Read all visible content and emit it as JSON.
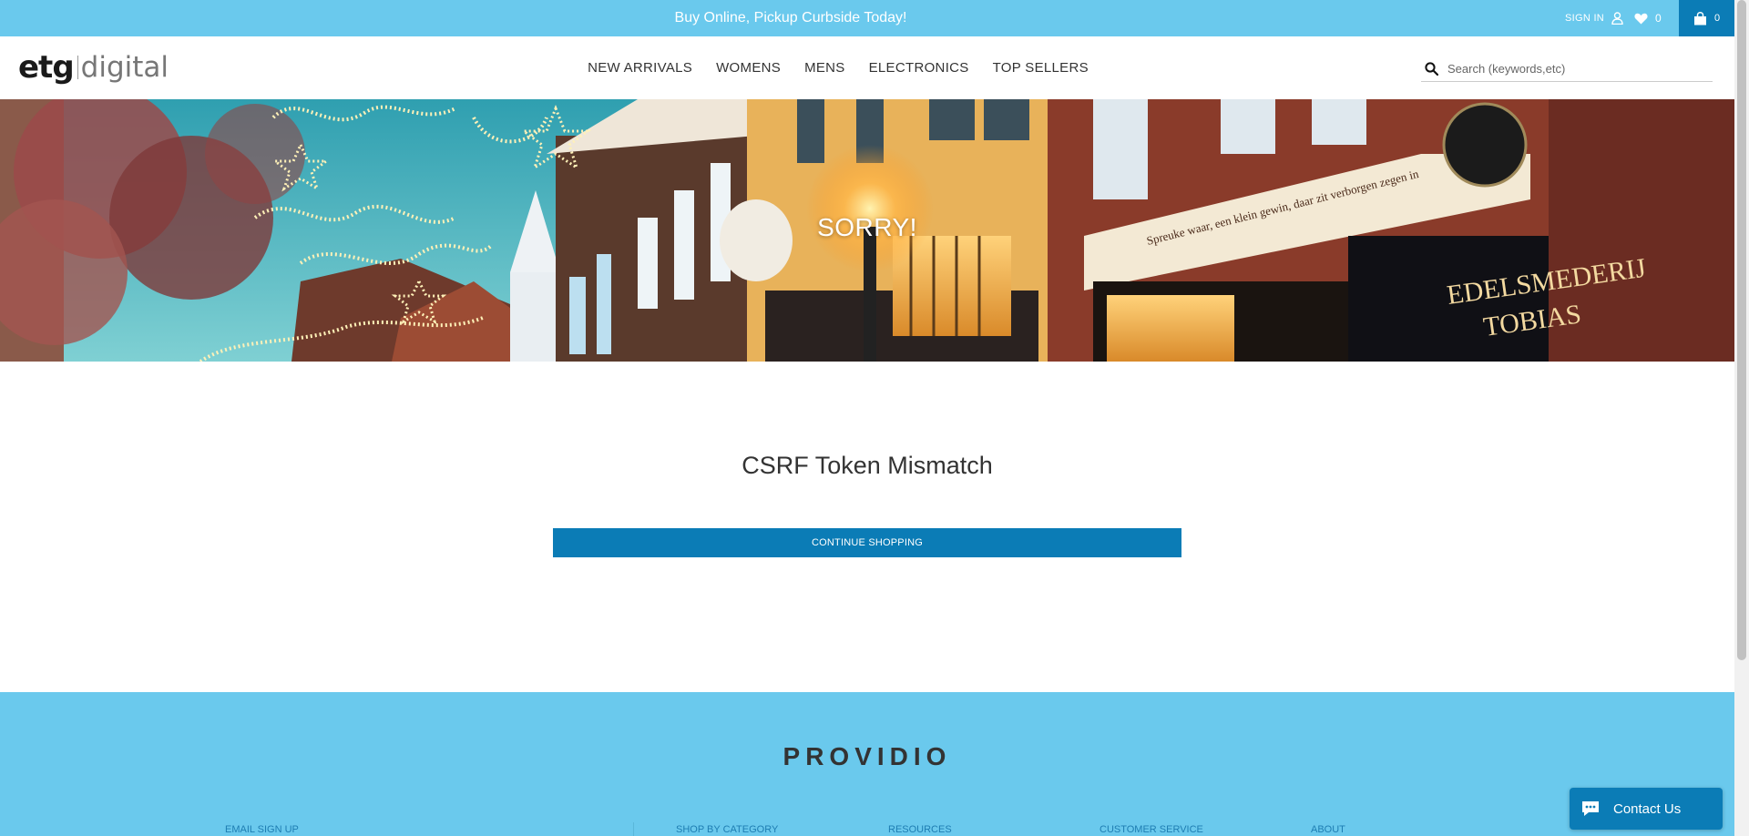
{
  "announcement": {
    "text": "Buy Online, Pickup Curbside Today!",
    "sign_in_label": "SIGN IN",
    "wishlist_count": "0",
    "cart_count": "0"
  },
  "header": {
    "logo_mark": "etg",
    "logo_word": "digital",
    "nav": [
      "NEW ARRIVALS",
      "WOMENS",
      "MENS",
      "ELECTRONICS",
      "TOP SELLERS"
    ],
    "search_placeholder": "Search (keywords,etc)"
  },
  "hero": {
    "title": "SORRY!",
    "sign_text_1": "EDELSMEDERIJ",
    "sign_text_2": "TOBIAS",
    "facade_text": "Spreuke waar, een klein gewin, daar zit verborgen zegen in"
  },
  "error": {
    "heading": "CSRF Token Mismatch",
    "button_label": "CONTINUE SHOPPING"
  },
  "footer": {
    "brand": "PROVIDIO",
    "columns": [
      "EMAIL SIGN UP",
      "SHOP BY CATEGORY",
      "RESOURCES",
      "CUSTOMER SERVICE",
      "ABOUT"
    ]
  },
  "chat": {
    "label": "Contact Us"
  },
  "colors": {
    "accent_light": "#6ac9ed",
    "accent_dark": "#0b7cb6",
    "text": "#333333"
  },
  "icons": [
    "user-icon",
    "heart-icon",
    "shopping-bag-icon",
    "search-icon",
    "chat-bubble-icon"
  ]
}
